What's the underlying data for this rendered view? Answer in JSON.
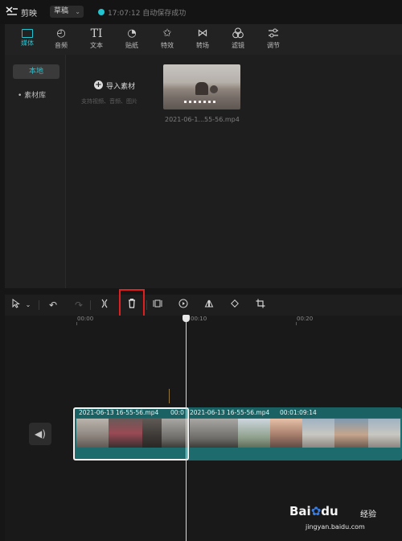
{
  "titlebar": {
    "app_name": "剪映",
    "draft_label": "草稿",
    "save_status": "17:07:12 自动保存成功"
  },
  "tabs": [
    {
      "label": "媒体",
      "icon": "media-icon",
      "active": true
    },
    {
      "label": "音频",
      "icon": "audio-icon"
    },
    {
      "label": "文本",
      "icon": "text-icon",
      "glyph": "TI"
    },
    {
      "label": "贴纸",
      "icon": "sticker-icon"
    },
    {
      "label": "特效",
      "icon": "effects-icon"
    },
    {
      "label": "转场",
      "icon": "transition-icon"
    },
    {
      "label": "滤镜",
      "icon": "filter-icon"
    },
    {
      "label": "调节",
      "icon": "adjust-icon"
    }
  ],
  "sidebar": {
    "local": "本地",
    "library": "素材库"
  },
  "import": {
    "label": "导入素材",
    "hint": "支持视频、音频、图片"
  },
  "media_item": {
    "name": "2021-06-1...55-56.mp4"
  },
  "ruler": {
    "t0": "00:00",
    "t10": "00:10",
    "t20": "00:20"
  },
  "clips": [
    {
      "name": "2021-06-13 16-55-56.mp4",
      "duration": "00:0"
    },
    {
      "name": "2021-06-13 16-55-56.mp4",
      "duration": "00:01:09:14"
    }
  ],
  "watermark": {
    "brand": "Bai",
    "brand2": "du",
    "cn": "经验",
    "url": "jingyan.baidu.com"
  },
  "colors": {
    "accent": "#23c4d1",
    "track": "#1e6b6e",
    "highlight": "#e02020"
  }
}
